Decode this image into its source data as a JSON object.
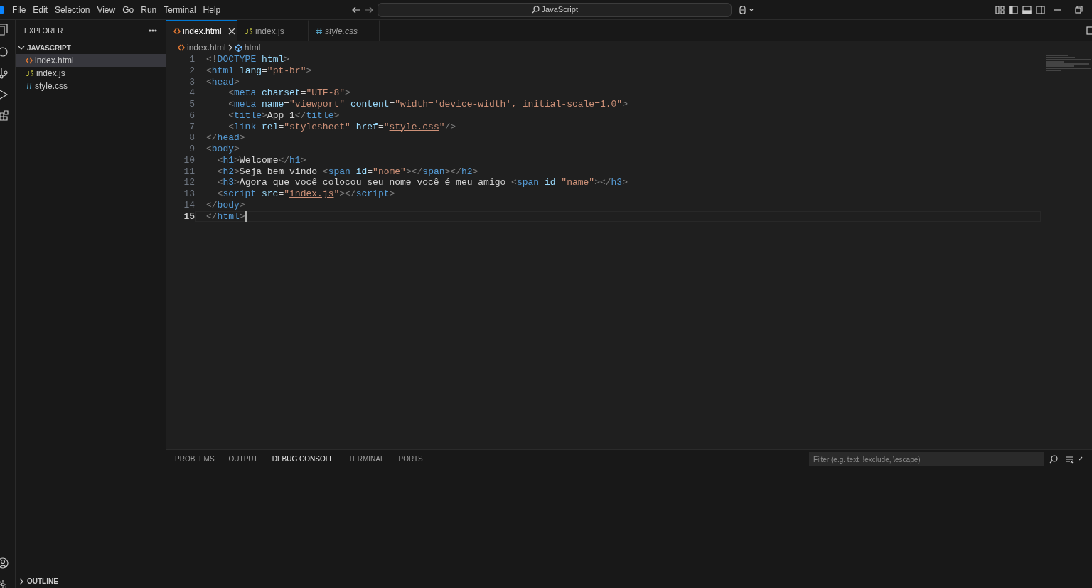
{
  "menu": [
    "File",
    "Edit",
    "Selection",
    "View",
    "Go",
    "Run",
    "Terminal",
    "Help"
  ],
  "command_center": {
    "text": "JavaScript"
  },
  "explorer": {
    "title": "EXPLORER",
    "folder": {
      "label": "JAVASCRIPT",
      "expanded": true,
      "files": [
        {
          "name": "index.html",
          "kind": "html",
          "selected": true
        },
        {
          "name": "index.js",
          "kind": "js",
          "selected": false
        },
        {
          "name": "style.css",
          "kind": "css",
          "selected": false
        }
      ]
    },
    "outline": {
      "label": "OUTLINE",
      "expanded": false
    }
  },
  "tabs": [
    {
      "label": "index.html",
      "kind": "html",
      "selected": true,
      "preview": false
    },
    {
      "label": "index.js",
      "kind": "js",
      "selected": false,
      "preview": false
    },
    {
      "label": "style.css",
      "kind": "css",
      "selected": false,
      "preview": true
    }
  ],
  "breadcrumbs": [
    "index.html",
    "html"
  ],
  "code": [
    {
      "number": "1",
      "current": false,
      "tokens": [
        {
          "kind": "punct",
          "text": "<!"
        },
        {
          "kind": "tag",
          "text": "DOCTYPE "
        },
        {
          "kind": "attr",
          "text": "html"
        },
        {
          "kind": "punct",
          "text": ">"
        }
      ]
    },
    {
      "number": "2",
      "current": false,
      "tokens": [
        {
          "kind": "punct",
          "text": "<"
        },
        {
          "kind": "tag",
          "text": "html "
        },
        {
          "kind": "attr",
          "text": "lang"
        },
        {
          "kind": "text",
          "text": "="
        },
        {
          "kind": "str",
          "text": "\"pt-br\""
        },
        {
          "kind": "punct",
          "text": ">"
        }
      ]
    },
    {
      "number": "3",
      "current": false,
      "tokens": [
        {
          "kind": "punct",
          "text": "<"
        },
        {
          "kind": "tag",
          "text": "head"
        },
        {
          "kind": "punct",
          "text": ">"
        }
      ]
    },
    {
      "number": "4",
      "current": false,
      "tokens": [
        {
          "kind": "punct",
          "text": "    <"
        },
        {
          "kind": "tag",
          "text": "meta "
        },
        {
          "kind": "attr",
          "text": "charset"
        },
        {
          "kind": "text",
          "text": "="
        },
        {
          "kind": "str",
          "text": "\"UTF-8\""
        },
        {
          "kind": "punct",
          "text": ">"
        }
      ]
    },
    {
      "number": "5",
      "current": false,
      "tokens": [
        {
          "kind": "punct",
          "text": "    <"
        },
        {
          "kind": "tag",
          "text": "meta "
        },
        {
          "kind": "attr",
          "text": "name"
        },
        {
          "kind": "text",
          "text": "="
        },
        {
          "kind": "str",
          "text": "\"viewport\" "
        },
        {
          "kind": "attr",
          "text": "content"
        },
        {
          "kind": "text",
          "text": "="
        },
        {
          "kind": "str",
          "text": "\"width='device-width', initial-scale=1.0\""
        },
        {
          "kind": "punct",
          "text": ">"
        }
      ]
    },
    {
      "number": "6",
      "current": false,
      "tokens": [
        {
          "kind": "punct",
          "text": "    <"
        },
        {
          "kind": "tag",
          "text": "title"
        },
        {
          "kind": "punct",
          "text": ">"
        },
        {
          "kind": "text",
          "text": "App 1"
        },
        {
          "kind": "punct",
          "text": "</"
        },
        {
          "kind": "tag",
          "text": "title"
        },
        {
          "kind": "punct",
          "text": ">"
        }
      ]
    },
    {
      "number": "7",
      "current": false,
      "tokens": [
        {
          "kind": "punct",
          "text": "    <"
        },
        {
          "kind": "tag",
          "text": "link "
        },
        {
          "kind": "attr",
          "text": "rel"
        },
        {
          "kind": "text",
          "text": "="
        },
        {
          "kind": "str",
          "text": "\"stylesheet\" "
        },
        {
          "kind": "attr",
          "text": "href"
        },
        {
          "kind": "text",
          "text": "="
        },
        {
          "kind": "str",
          "text": "\""
        },
        {
          "kind": "link",
          "text": "style.css"
        },
        {
          "kind": "str",
          "text": "\""
        },
        {
          "kind": "punct",
          "text": "/>"
        }
      ]
    },
    {
      "number": "8",
      "current": false,
      "tokens": [
        {
          "kind": "punct",
          "text": "</"
        },
        {
          "kind": "tag",
          "text": "head"
        },
        {
          "kind": "punct",
          "text": ">"
        }
      ]
    },
    {
      "number": "9",
      "current": false,
      "tokens": [
        {
          "kind": "punct",
          "text": "<"
        },
        {
          "kind": "tag",
          "text": "body"
        },
        {
          "kind": "punct",
          "text": ">"
        }
      ]
    },
    {
      "number": "10",
      "current": false,
      "tokens": [
        {
          "kind": "punct",
          "text": "  <"
        },
        {
          "kind": "tag",
          "text": "h1"
        },
        {
          "kind": "punct",
          "text": ">"
        },
        {
          "kind": "text",
          "text": "Welcome"
        },
        {
          "kind": "punct",
          "text": "</"
        },
        {
          "kind": "tag",
          "text": "h1"
        },
        {
          "kind": "punct",
          "text": ">"
        }
      ]
    },
    {
      "number": "11",
      "current": false,
      "tokens": [
        {
          "kind": "punct",
          "text": "  <"
        },
        {
          "kind": "tag",
          "text": "h2"
        },
        {
          "kind": "punct",
          "text": ">"
        },
        {
          "kind": "text",
          "text": "Seja bem vindo "
        },
        {
          "kind": "punct",
          "text": "<"
        },
        {
          "kind": "tag",
          "text": "span "
        },
        {
          "kind": "attr",
          "text": "id"
        },
        {
          "kind": "text",
          "text": "="
        },
        {
          "kind": "str",
          "text": "\"nome\""
        },
        {
          "kind": "punct",
          "text": "></"
        },
        {
          "kind": "tag",
          "text": "span"
        },
        {
          "kind": "punct",
          "text": "></"
        },
        {
          "kind": "tag",
          "text": "h2"
        },
        {
          "kind": "punct",
          "text": ">"
        }
      ]
    },
    {
      "number": "12",
      "current": false,
      "tokens": [
        {
          "kind": "punct",
          "text": "  <"
        },
        {
          "kind": "tag",
          "text": "h3"
        },
        {
          "kind": "punct",
          "text": ">"
        },
        {
          "kind": "text",
          "text": "Agora que você colocou seu nome você é meu amigo "
        },
        {
          "kind": "punct",
          "text": "<"
        },
        {
          "kind": "tag",
          "text": "span "
        },
        {
          "kind": "attr",
          "text": "id"
        },
        {
          "kind": "text",
          "text": "="
        },
        {
          "kind": "str",
          "text": "\"name\""
        },
        {
          "kind": "punct",
          "text": "></"
        },
        {
          "kind": "tag",
          "text": "h3"
        },
        {
          "kind": "punct",
          "text": ">"
        }
      ]
    },
    {
      "number": "13",
      "current": false,
      "tokens": [
        {
          "kind": "punct",
          "text": "  <"
        },
        {
          "kind": "tag",
          "text": "script "
        },
        {
          "kind": "attr",
          "text": "src"
        },
        {
          "kind": "text",
          "text": "="
        },
        {
          "kind": "str",
          "text": "\""
        },
        {
          "kind": "link",
          "text": "index.js"
        },
        {
          "kind": "str",
          "text": "\""
        },
        {
          "kind": "punct",
          "text": "></"
        },
        {
          "kind": "tag",
          "text": "script"
        },
        {
          "kind": "punct",
          "text": ">"
        }
      ]
    },
    {
      "number": "14",
      "current": false,
      "tokens": [
        {
          "kind": "punct",
          "text": "</"
        },
        {
          "kind": "tag",
          "text": "body"
        },
        {
          "kind": "punct",
          "text": ">"
        }
      ]
    },
    {
      "number": "15",
      "current": true,
      "tokens": [
        {
          "kind": "punct",
          "text": "</"
        },
        {
          "kind": "tag",
          "text": "html"
        },
        {
          "kind": "punct",
          "text": ">"
        }
      ]
    }
  ],
  "panel": {
    "tabs": [
      {
        "label": "PROBLEMS",
        "selected": false
      },
      {
        "label": "OUTPUT",
        "selected": false
      },
      {
        "label": "DEBUG CONSOLE",
        "selected": true
      },
      {
        "label": "TERMINAL",
        "selected": false
      },
      {
        "label": "PORTS",
        "selected": false
      }
    ],
    "filter": {
      "placeholder": "Filter (e.g. text, !exclude, \\escape)"
    }
  }
}
